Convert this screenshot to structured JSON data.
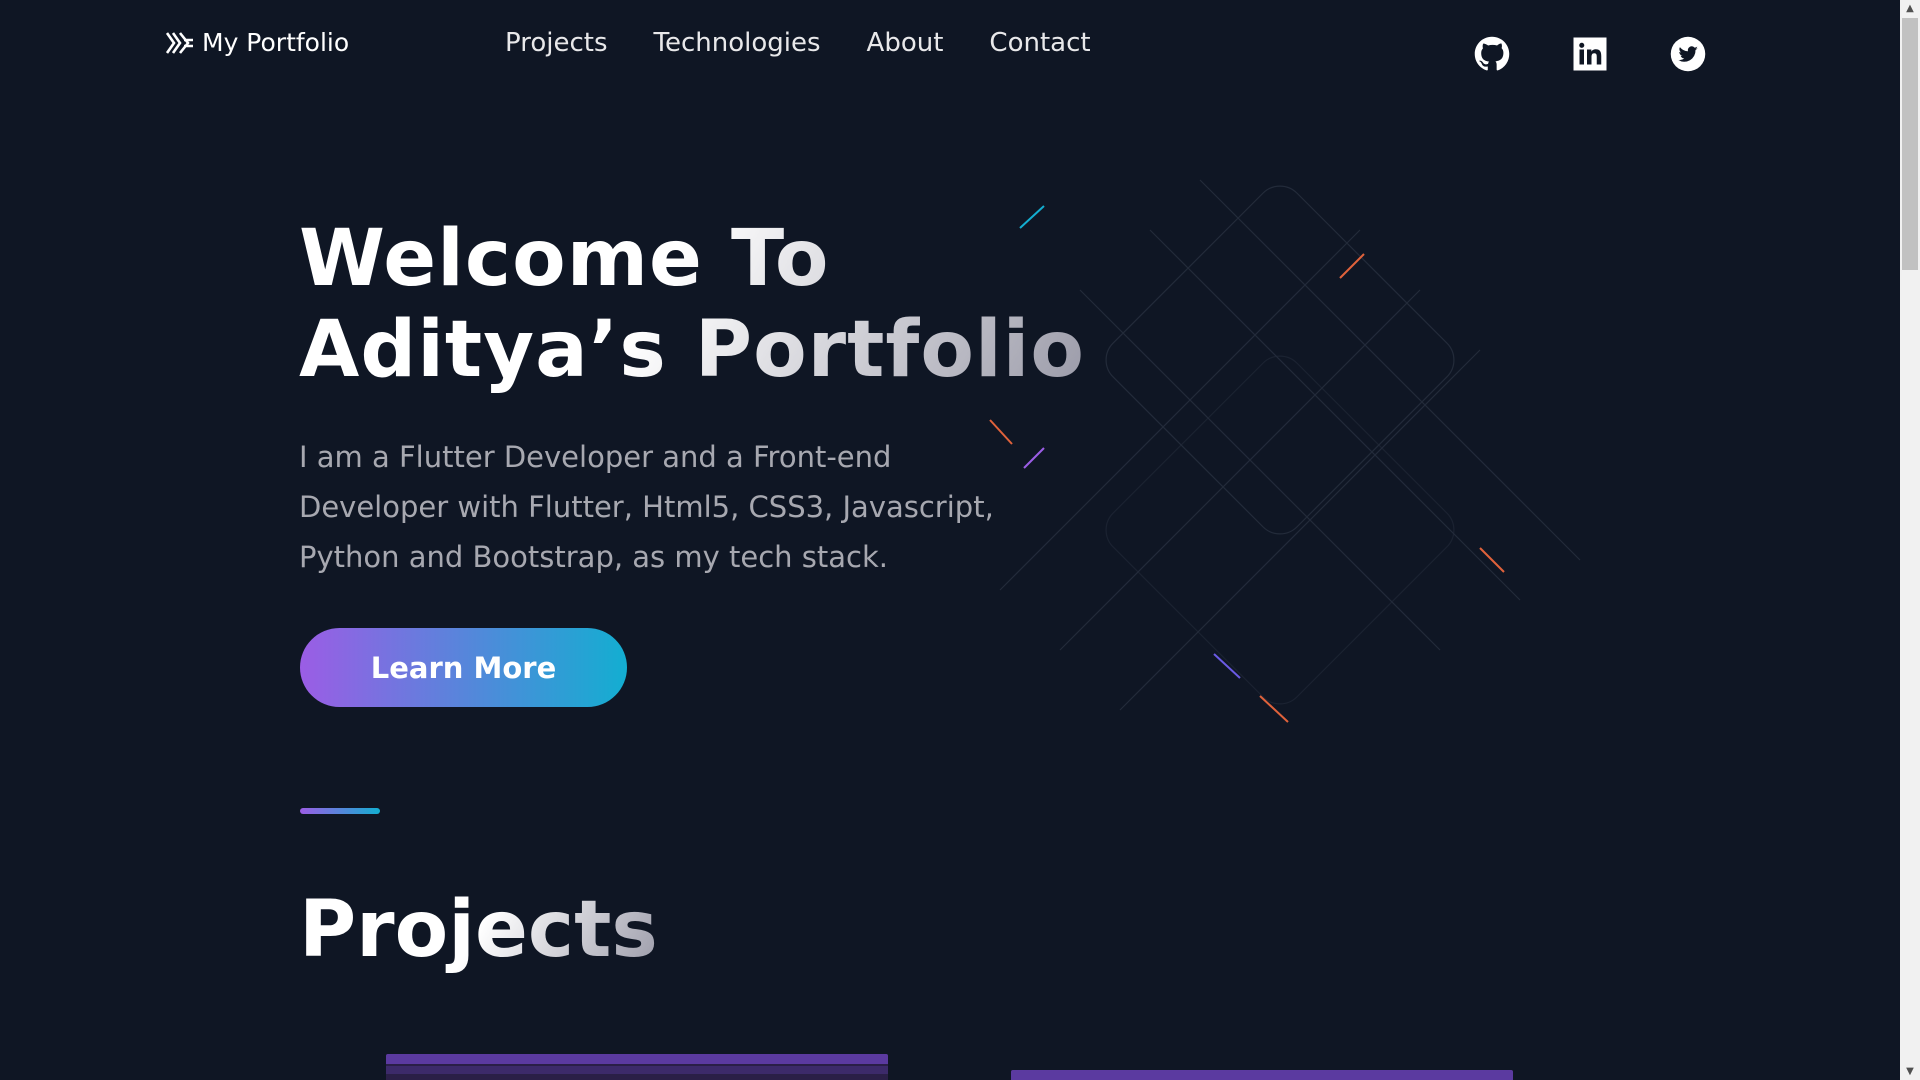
{
  "header": {
    "logo_text": "My Portfolio",
    "nav": [
      "Projects",
      "Technologies",
      "About",
      "Contact"
    ],
    "social": [
      "github-icon",
      "linkedin-icon",
      "twitter-icon"
    ]
  },
  "hero": {
    "title_line1": "Welcome To",
    "title_line2": "Aditya’s Portfolio",
    "text": "I am a Flutter Developer and a Front-end Developer with Flutter, Html5, CSS3, Javascript, Python and Bootstrap, as my tech stack.",
    "button": "Learn More"
  },
  "projects": {
    "title": "Projects"
  },
  "colors": {
    "background": "#0f1624",
    "gradient_start": "#9b5de5",
    "gradient_end": "#13aed1"
  }
}
